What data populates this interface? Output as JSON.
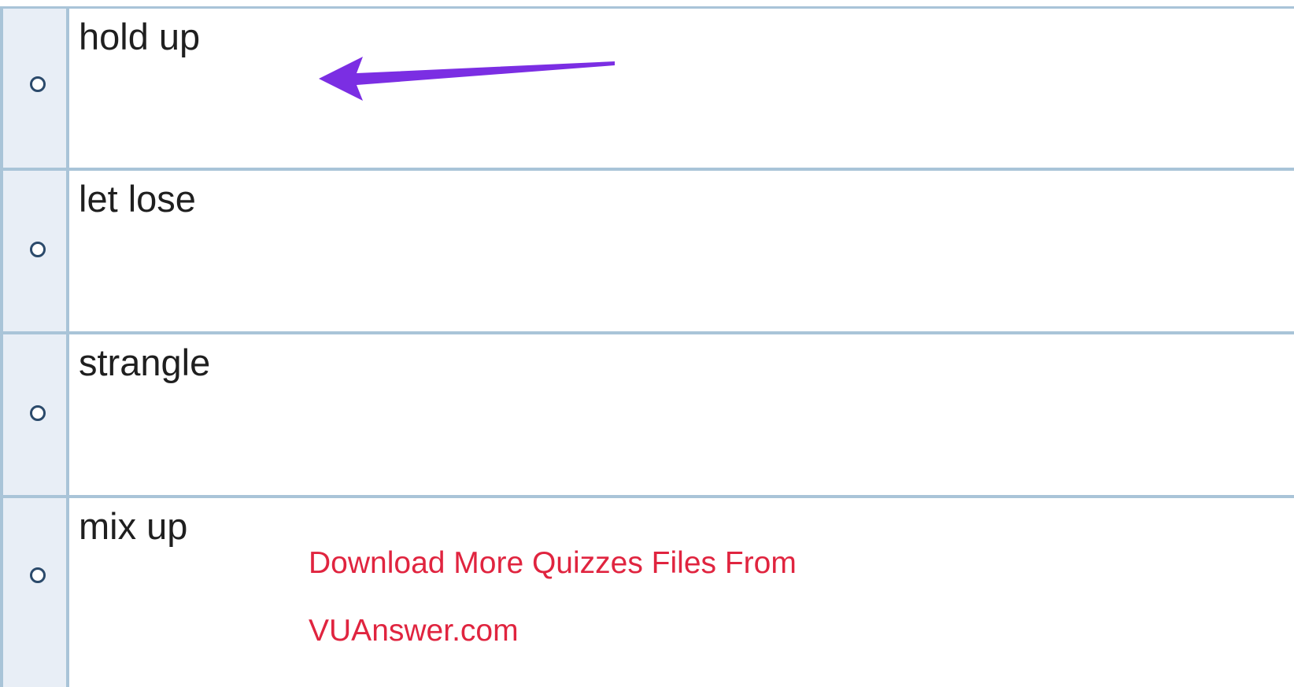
{
  "options": [
    {
      "label": "hold up",
      "selected": false
    },
    {
      "label": "let lose",
      "selected": false
    },
    {
      "label": "strangle",
      "selected": false
    },
    {
      "label": "mix up",
      "selected": false
    }
  ],
  "annotation": {
    "icon": "arrow-left-icon",
    "color": "#7b2ee3"
  },
  "watermark": {
    "line1": "Download More Quizzes Files From",
    "line2": "VUAnswer.com",
    "color": "#e0243f"
  },
  "colors": {
    "border": "#a9c4d8",
    "radio_cell_bg": "#e8eef6",
    "radio_ring": "#2b4a6b"
  }
}
